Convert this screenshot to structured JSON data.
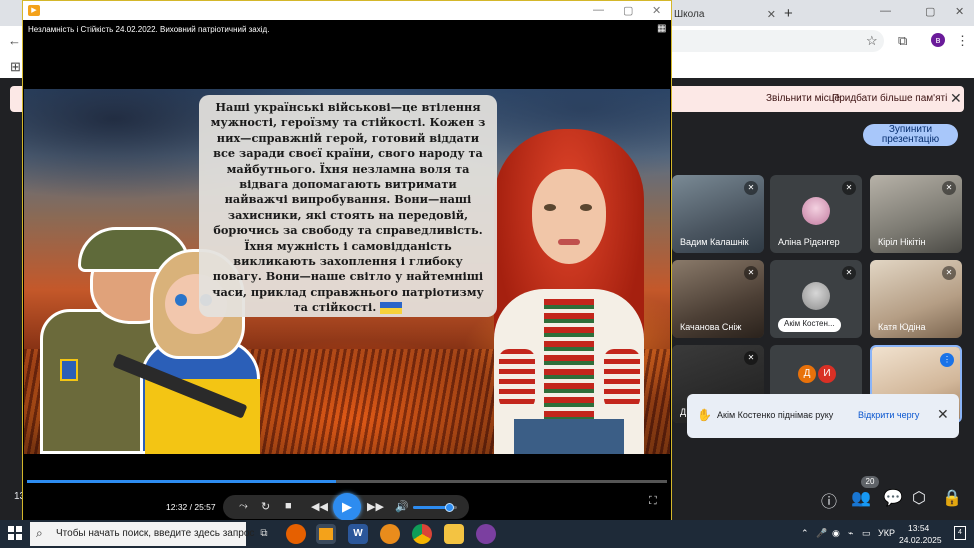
{
  "browser": {
    "tab_label": "Школа",
    "tab_close": "✕",
    "new_tab": "+",
    "win_minimize": "—",
    "win_maximize": "▢",
    "win_close": "✕",
    "profile_initial": "в"
  },
  "banner": {
    "free_space": "Звільнити місце",
    "buy_memory": "Придбати більше пам'яті",
    "close": "✕"
  },
  "meet": {
    "stop_presenting": "Зупинити презентацію",
    "timer": "13",
    "people_count": "20",
    "tiles": [
      {
        "name": "Вадим Калашнік"
      },
      {
        "name": "Аліна Рідєнгер"
      },
      {
        "name": "Кіріл Нікітін"
      },
      {
        "name": "Качанова Сніж"
      },
      {
        "name": "Акім Костен..."
      },
      {
        "name": "Катя Юдіна"
      },
      {
        "name": "Д"
      },
      {
        "initials": [
          "Д",
          "И"
        ]
      },
      {
        "name": ""
      }
    ],
    "toast": {
      "message": "Акім Костенко піднімає руку",
      "action": "Відкрити чергу",
      "close": "✕"
    }
  },
  "player": {
    "window_title": "Незламність і Стійкість 24.02.2022. Виховний патріотичний захід.",
    "quote": "Наші українські військові—це втілення мужності, героїзму та стійкості. Кожен з них—справжній герой, готовий віддати все заради своєї країни, свого народу та майбутнього. Їхня незламна воля та відвага допомагають витримати найважчі випробування. Вони—наші захисники, які стоять на передовій, борючись за свободу та справедливість. Їхня мужність і самовідданість викликають захоплення і глибоку повагу. Вони—наше світло у найтемніші часи, приклад справжнього патріотизму та стійкості.",
    "time": "12:32 / 25:57",
    "progress": 0.483,
    "volume": 0.85
  },
  "taskbar": {
    "search_placeholder": "Чтобы начать поиск, введите здесь запрос",
    "language": "УКР",
    "time": "13:54",
    "date": "24.02.2025",
    "notifications": "4"
  },
  "colors": {
    "accent": "#2d8cf0",
    "player_border": "#d4b72a",
    "banner_bg": "#fce8e6",
    "stop_presenting_bg": "#a8c7fa"
  }
}
